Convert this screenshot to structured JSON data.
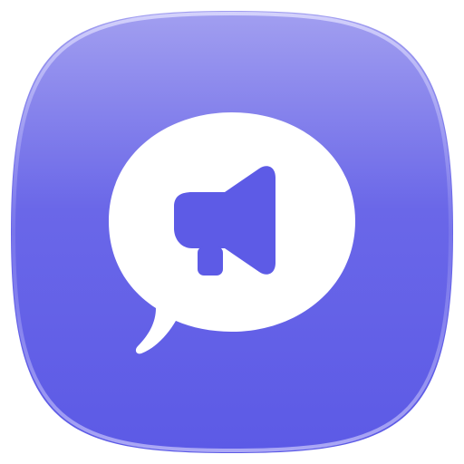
{
  "app_icon": {
    "icon": "speech-bubble-megaphone-icon",
    "colors": {
      "background_top": "#a29ff0",
      "background_mid": "#6a67e8",
      "background_bottom": "#5c5ae6",
      "edge_highlight": "#c9c6fb",
      "glyph": "#ffffff",
      "megaphone": "#5d5be6"
    }
  }
}
